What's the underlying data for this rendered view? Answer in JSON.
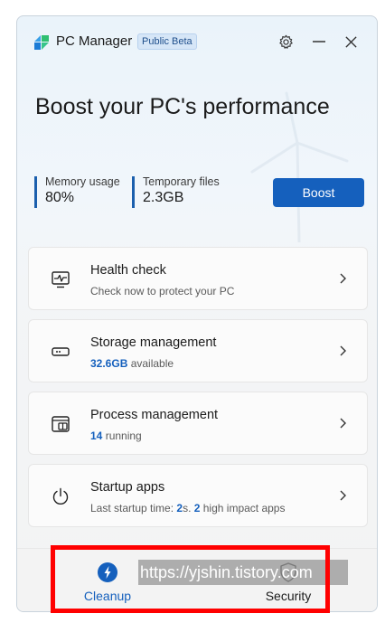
{
  "header": {
    "app_title": "PC Manager",
    "badge": "Public Beta"
  },
  "hero": {
    "headline": "Boost your PC's performance"
  },
  "stats": [
    {
      "label": "Memory usage",
      "value": "80%"
    },
    {
      "label": "Temporary files",
      "value": "2.3GB"
    }
  ],
  "boost_label": "Boost",
  "cards": {
    "health": {
      "title": "Health check",
      "sub": "Check now to protect your PC"
    },
    "storage": {
      "title": "Storage management",
      "value": "32.6GB",
      "suffix": " available"
    },
    "process": {
      "title": "Process management",
      "value": "14",
      "suffix": " running"
    },
    "startup": {
      "title": "Startup apps",
      "prefix": "Last startup time: ",
      "value1": "2",
      "mid": "s. ",
      "value2": "2",
      "suffix": " high impact apps"
    }
  },
  "nav": {
    "cleanup": "Cleanup",
    "security": "Security"
  },
  "watermark": "https://yjshin.tistory.com",
  "colors": {
    "accent": "#1560bd",
    "highlight": "#ff0000"
  }
}
